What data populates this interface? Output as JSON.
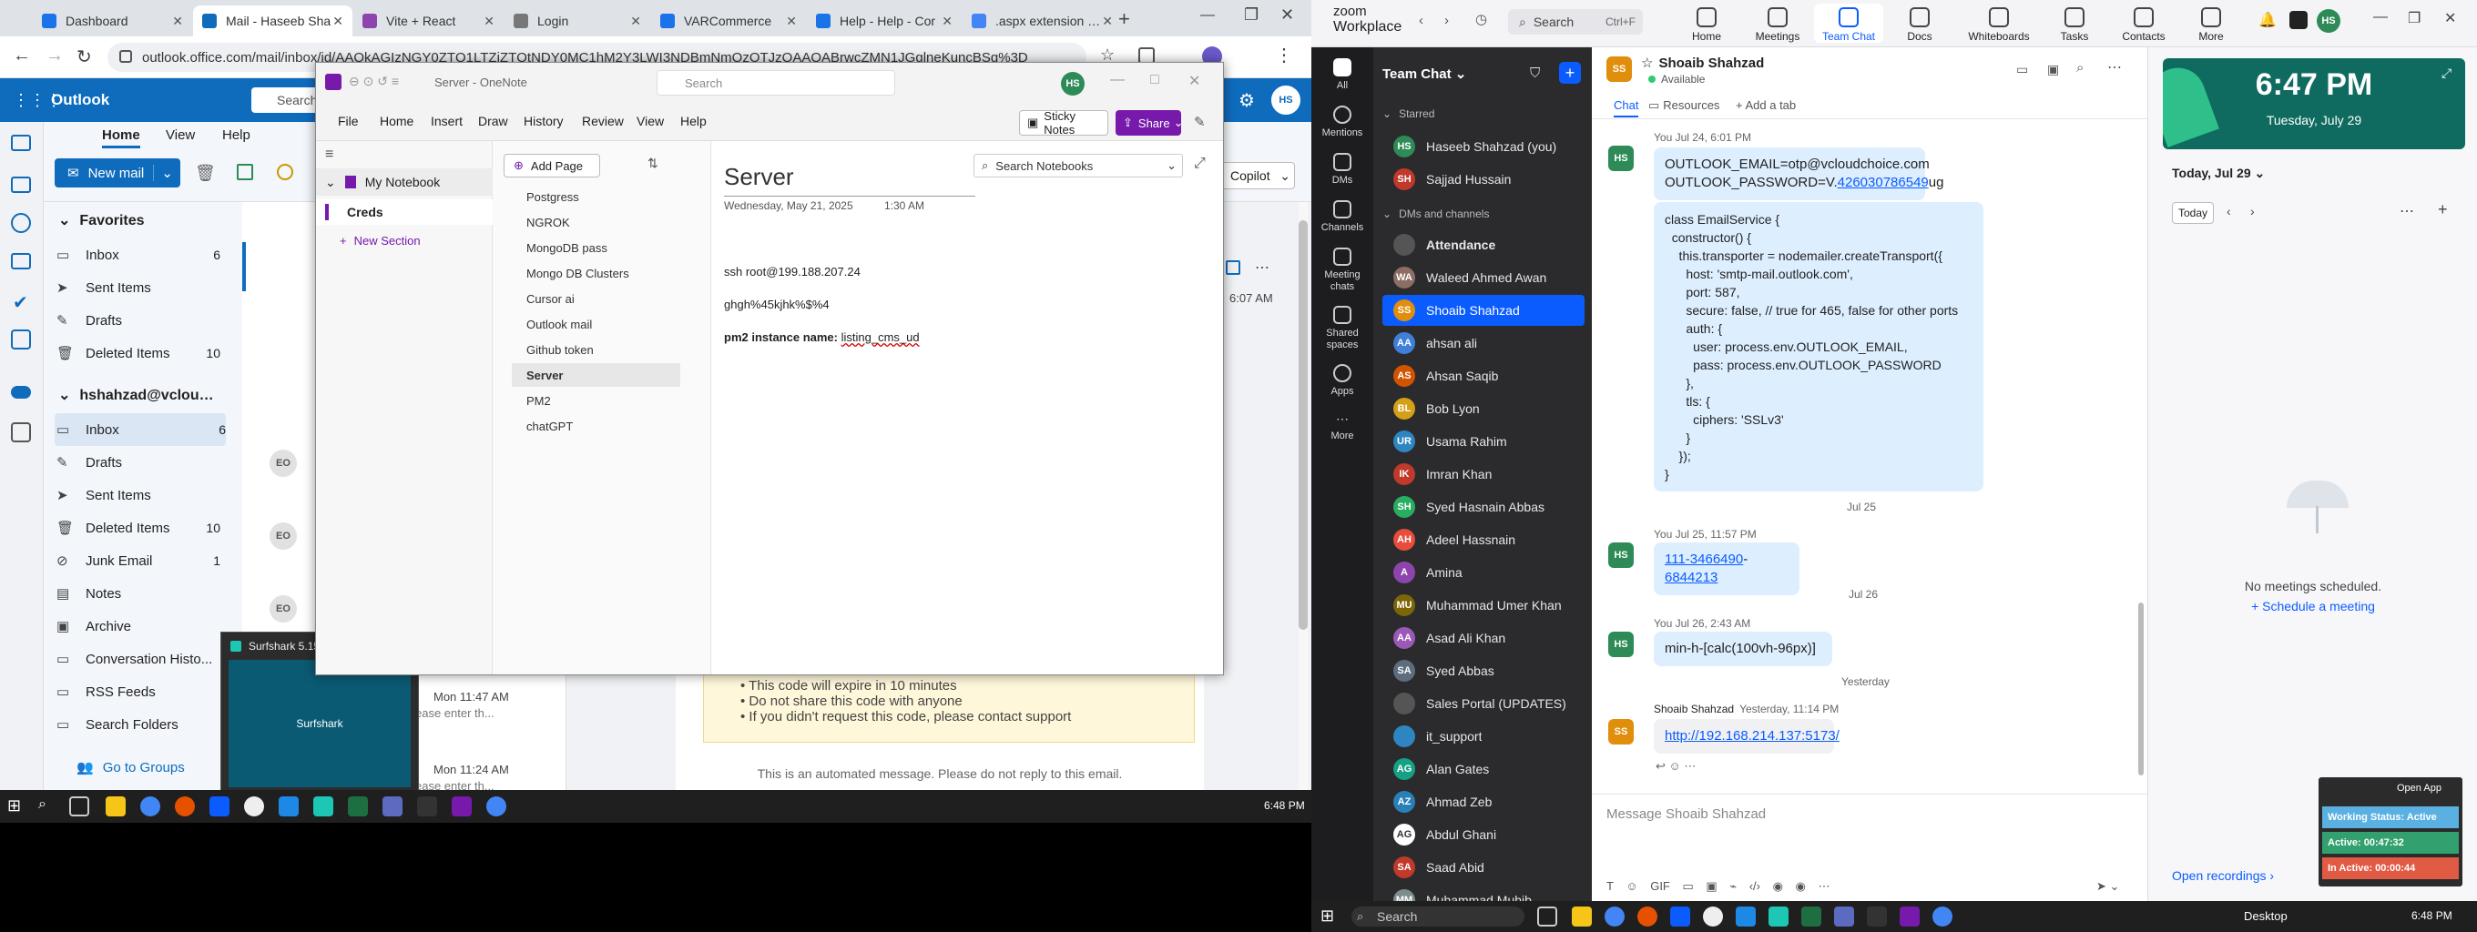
{
  "chrome": {
    "tabs": [
      {
        "title": "Dashboard",
        "color": "#1a73e8"
      },
      {
        "title": "Mail - Haseeb Sha",
        "color": "#0f6cbd"
      },
      {
        "title": "Vite + React",
        "color": "#8e44ad"
      },
      {
        "title": "Login",
        "color": "#777777"
      },
      {
        "title": "VARCommerce",
        "color": "#1a73e8"
      },
      {
        "title": "Help - Help - Cor",
        "color": "#1a73e8"
      },
      {
        "title": ".aspx extension - C",
        "color": "#4285f4"
      }
    ],
    "url": "outlook.office.com/mail/inbox/id/AAQkAGIzNGY0ZTQ1LTZiZTQtNDY0MC1hM2Y3LWI3NDBmNmQzOTJzQAAQABrwcZMN1JGqlneKuncBSq%3D"
  },
  "outlook": {
    "app_name": "Outlook",
    "search_placeholder": "Search",
    "ribbon_tabs": [
      "Home",
      "View",
      "Help"
    ],
    "new_mail": "New mail",
    "copilot": "Copilot",
    "favorites_label": "Favorites",
    "favorites": [
      {
        "name": "Inbox",
        "count": "6"
      },
      {
        "name": "Sent Items",
        "count": ""
      },
      {
        "name": "Drafts",
        "count": ""
      },
      {
        "name": "Deleted Items",
        "count": "10"
      }
    ],
    "account": "hshahzad@vcloudc...",
    "folders": [
      {
        "name": "Inbox",
        "count": "6"
      },
      {
        "name": "Drafts",
        "count": ""
      },
      {
        "name": "Sent Items",
        "count": ""
      },
      {
        "name": "Deleted Items",
        "count": "10"
      },
      {
        "name": "Junk Email",
        "count": "1"
      },
      {
        "name": "Notes",
        "count": ""
      },
      {
        "name": "Archive",
        "count": ""
      },
      {
        "name": "Conversation Histo...",
        "count": ""
      },
      {
        "name": "RSS Feeds",
        "count": ""
      },
      {
        "name": "Search Folders",
        "count": ""
      }
    ],
    "go_to_groups": "Go to Groups",
    "mail_time": "6:07 AM",
    "list_times": [
      "Mon 11:47 AM",
      "Mon 11:24 AM"
    ],
    "list_snippet": "ease enter th...",
    "email_notes": [
      "This code will expire in 10 minutes",
      "Do not share this code with anyone",
      "If you didn't request this code, please contact support"
    ],
    "email_footer": "This is an automated message. Please do not reply to this email."
  },
  "surfshark": {
    "title": "Surfshark 5.15.2",
    "logo": "Surfshark"
  },
  "onenote": {
    "title": "Server - OneNote",
    "search_placeholder": "Search",
    "user_initials": "HS",
    "menu": [
      "File",
      "Home",
      "Insert",
      "Draw",
      "History",
      "Review",
      "View",
      "Help"
    ],
    "sticky_notes": "Sticky Notes",
    "share": "Share",
    "notebook": "My Notebook",
    "section": "Creds",
    "new_section": "New Section",
    "add_page": "Add Page",
    "pages": [
      "Postgress",
      "NGROK",
      "MongoDB pass",
      "Mongo DB Clusters",
      "Cursor ai",
      "Outlook mail",
      "Github token",
      "Server",
      "PM2",
      "chatGPT"
    ],
    "selected_page": "Server",
    "search_notebooks": "Search Notebooks",
    "page_title": "Server",
    "page_date": "Wednesday, May 21, 2025",
    "page_time": "1:30 AM",
    "lines": [
      "ssh root@199.188.207.24",
      "ghgh%45kjhk%$%4"
    ],
    "pm2_label": "pm2 instance name:",
    "pm2_value": "listing_cms_ud"
  },
  "zoom": {
    "brand_top": "zoom",
    "brand_bottom": "Workplace",
    "search": "Search",
    "search_shortcut": "Ctrl+F",
    "user_initials": "HS",
    "nav": [
      "Home",
      "Meetings",
      "Team Chat",
      "Docs",
      "Whiteboards",
      "Tasks",
      "Contacts",
      "More"
    ],
    "rail": [
      "All",
      "Mentions",
      "DMs",
      "Channels",
      "Meeting chats",
      "Shared spaces",
      "Apps",
      "More"
    ],
    "panel_title": "Team Chat",
    "starred_label": "Starred",
    "starred": [
      {
        "name": "Haseeb Shahzad (you)",
        "initials": "HS",
        "color": "#2e8b57"
      },
      {
        "name": "Sajjad Hussain",
        "initials": "SH",
        "color": "#c0392b"
      }
    ],
    "dms_label": "DMs and channels",
    "contacts": [
      {
        "name": "Attendance",
        "initials": "",
        "color": "#555555",
        "bold": true
      },
      {
        "name": "Waleed Ahmed Awan",
        "initials": "WA",
        "color": "#8d6e63"
      },
      {
        "name": "Shoaib Shahzad",
        "initials": "SS",
        "color": "#e08e0b"
      },
      {
        "name": "ahsan ali",
        "initials": "AA",
        "color": "#3f7fd8"
      },
      {
        "name": "Ahsan Saqib",
        "initials": "AS",
        "color": "#d35400"
      },
      {
        "name": "Bob Lyon",
        "initials": "BL",
        "color": "#d4a017"
      },
      {
        "name": "Usama Rahim",
        "initials": "UR",
        "color": "#2e86c1"
      },
      {
        "name": "Imran Khan",
        "initials": "IK",
        "color": "#c0392b"
      },
      {
        "name": "Syed Hasnain Abbas",
        "initials": "SH",
        "color": "#27ae60"
      },
      {
        "name": "Adeel Hassnain",
        "initials": "AH",
        "color": "#e74c3c"
      },
      {
        "name": "Amina",
        "initials": "A",
        "color": "#8e44ad"
      },
      {
        "name": "Muhammad Umer Khan",
        "initials": "MU",
        "color": "#7d6608"
      },
      {
        "name": "Asad Ali Khan",
        "initials": "AA",
        "color": "#9b59b6"
      },
      {
        "name": "Syed Abbas",
        "initials": "SA",
        "color": "#5d6d7e"
      },
      {
        "name": "Sales Portal (UPDATES)",
        "initials": "",
        "color": "#555555"
      },
      {
        "name": "it_support",
        "initials": "",
        "color": "#2e86c1"
      },
      {
        "name": "Alan Gates",
        "initials": "AG",
        "color": "#16a085"
      },
      {
        "name": "Ahmad Zeb",
        "initials": "AZ",
        "color": "#2980b9"
      },
      {
        "name": "Abdul Ghani",
        "initials": "AG",
        "color": "#ffffff"
      },
      {
        "name": "Saad Abid",
        "initials": "SA",
        "color": "#c0392b"
      },
      {
        "name": "Muhammad Muhib",
        "initials": "MM",
        "color": "#7f8c8d"
      }
    ],
    "chat": {
      "name": "Shoaib Shahzad",
      "initials": "SS",
      "status": "Available",
      "tabs": [
        "Chat",
        "Resources",
        "+ Add a tab"
      ],
      "msg1_meta": "You Jul 24, 6:01 PM",
      "msg1_line1": "OUTLOOK_EMAIL=otp@vcloudchoice.com",
      "msg1_line2a": "OUTLOOK_PASSWORD=V.",
      "msg1_line2b": "426030786549",
      "msg1_line2c": "ug",
      "code": [
        "class EmailService {",
        "  constructor() {",
        "    this.transporter = nodemailer.createTransport({",
        "      host: 'smtp-mail.outlook.com',",
        "      port: 587,",
        "      secure: false, // true for 465, false for other ports",
        "      auth: {",
        "        user: process.env.OUTLOOK_EMAIL,",
        "        pass: process.env.OUTLOOK_PASSWORD",
        "      },",
        "      tls: {",
        "        ciphers: 'SSLv3'",
        "      }",
        "    });",
        "}"
      ],
      "sep1": "Jul 25",
      "msg2_meta": "You Jul 25, 11:57 PM",
      "msg2_a": "111-3466490",
      "msg2_b": "-",
      "msg2_c": "6844213",
      "sep2": "Jul 26",
      "msg3_meta": "You Jul 26, 2:43 AM",
      "msg3": "min-h-[calc(100vh-96px)]",
      "sep3": "Yesterday",
      "msg4_sender": "Shoaib Shahzad",
      "msg4_time": "Yesterday, 11:14 PM",
      "msg4": "http://192.168.214.137:5173/",
      "composer_placeholder": "Message Shoaib Shahzad"
    },
    "calendar": {
      "time": "6:47 PM",
      "date": "Tuesday, July 29",
      "header": "Today, Jul 29",
      "today_btn": "Today",
      "empty": "No meetings scheduled.",
      "schedule": "Schedule a meeting",
      "open_recordings": "Open recordings"
    },
    "widget": {
      "open_app": "Open App",
      "status": "Working Status: Active",
      "active": "Active: 00:47:32",
      "inactive": "In Active: 00:00:44"
    }
  },
  "taskbar_left": {
    "time": "6:48 PM"
  },
  "taskbar_right": {
    "search": "Search",
    "desktop": "Desktop",
    "time": "6:48 PM"
  }
}
